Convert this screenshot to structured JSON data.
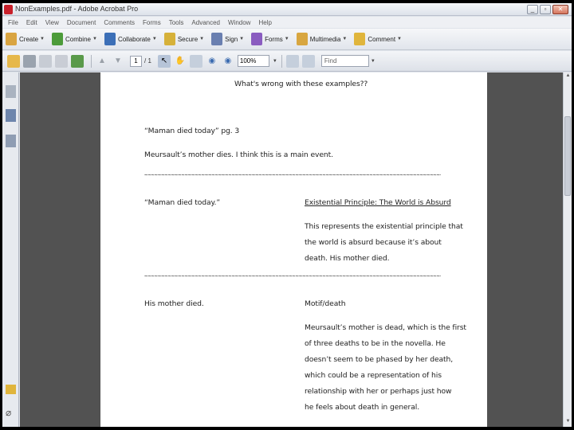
{
  "window": {
    "title": "NonExamples.pdf - Adobe Acrobat Pro",
    "min_label": "_",
    "max_label": "▫",
    "close_label": "✕"
  },
  "menu": [
    "File",
    "Edit",
    "View",
    "Document",
    "Comments",
    "Forms",
    "Tools",
    "Advanced",
    "Window",
    "Help"
  ],
  "tasks": [
    {
      "label": "Create",
      "color": "#d9a441"
    },
    {
      "label": "Combine",
      "color": "#4c9b3a"
    },
    {
      "label": "Collaborate",
      "color": "#3c6fb7"
    },
    {
      "label": "Secure",
      "color": "#d6b13a"
    },
    {
      "label": "Sign",
      "color": "#6a7fb0"
    },
    {
      "label": "Forms",
      "color": "#8a5cc0"
    },
    {
      "label": "Multimedia",
      "color": "#d8a640"
    },
    {
      "label": "Comment",
      "color": "#e0b53c"
    }
  ],
  "nav": {
    "page_current": "1",
    "page_total": "/ 1",
    "zoom": "100%",
    "find_placeholder": "Find"
  },
  "document": {
    "heading": "What's wrong with these examples??",
    "example1_quote": "“Maman died today” pg. 3",
    "example1_comment": "Meursault’s mother dies. I think this is a main event.",
    "divider": "~~~~~~~~~~~~~~~~~~~~~~~~~~~~~~~~~~~~~~~~~~~~~~~~~~~~~~~~~~~~~~~~~~~~~~~~~~~~~~~~~~~~~~~~~~",
    "example2_quote": "“Maman died today.”",
    "example2_heading": "Existential Principle: The World is Absurd",
    "example2_lines": [
      "This represents the existential principle that",
      "the world is absurd because it’s about",
      "death. His mother died."
    ],
    "example3_quote": "His mother died.",
    "example3_heading": "Motif/death",
    "example3_lines": [
      "Meursault’s mother is dead, which is the first",
      "of three deaths to be in the novella. He",
      "doesn’t seem to be phased by her death,",
      "which could be a representation of his",
      "relationship with her or perhaps just how",
      "he feels about death in general."
    ]
  }
}
